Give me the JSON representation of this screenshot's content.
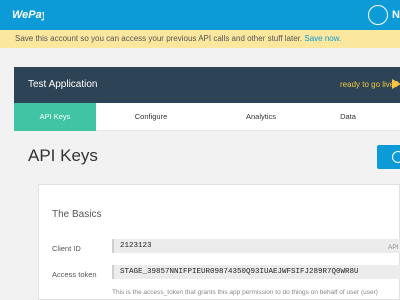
{
  "topbar": {
    "logo": "WePay",
    "user_initial": "N"
  },
  "banner": {
    "message": "Save this account so you can access your previous API calls and other stuff later.",
    "link": "Save now."
  },
  "app": {
    "title": "Test Application",
    "go_live": "ready to go live?"
  },
  "tabs": [
    {
      "label": "API Keys",
      "active": true
    },
    {
      "label": "Configure",
      "active": false
    },
    {
      "label": "Analytics",
      "active": false
    },
    {
      "label": "Data",
      "active": false
    }
  ],
  "page": {
    "title": "API Keys"
  },
  "basics": {
    "heading": "The Basics",
    "client_id_label": "Client ID",
    "client_id_value": "2123123",
    "client_id_tag": "API",
    "access_token_label": "Access token",
    "access_token_value": "STAGE_39857NNIFPIEUR09874350Q93IUAEJWFSIFJ289R7Q0WR8U",
    "access_token_help": "This is the access_token that grants this app permission to do things on behalf of user (user)"
  },
  "colors": {
    "brand": "#0c9bd6",
    "header": "#2c4455",
    "active_tab": "#40c4a4",
    "banner": "#fce79e"
  },
  "icons": [
    "wepay-logo",
    "user-icon",
    "arrow-right-icon",
    "plus-circle-icon"
  ]
}
